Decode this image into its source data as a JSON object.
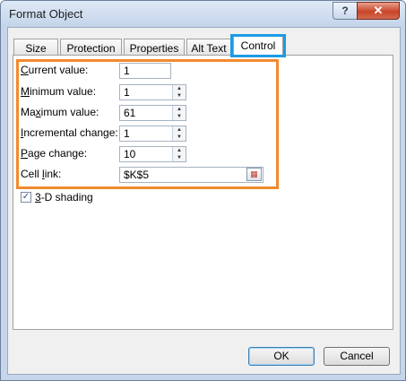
{
  "window": {
    "title": "Format Object",
    "help": "?",
    "close": "✕"
  },
  "tabs": [
    "Size",
    "Protection",
    "Properties",
    "Alt Text",
    "Control"
  ],
  "fields": {
    "current_value": {
      "label_key": "C",
      "label_rest": "urrent value:",
      "value": "1"
    },
    "minimum_value": {
      "label_key": "M",
      "label_rest": "inimum value:",
      "value": "1"
    },
    "maximum_value": {
      "label_pre": "Ma",
      "label_key": "x",
      "label_rest": "imum value:",
      "value": "61"
    },
    "incremental_change": {
      "label_key": "I",
      "label_rest": "ncremental change:",
      "value": "1"
    },
    "page_change": {
      "label_key": "P",
      "label_rest": "age change:",
      "value": "10"
    },
    "cell_link": {
      "label_pre": "Cell ",
      "label_key": "l",
      "label_rest": "ink:",
      "value": "$K$5"
    }
  },
  "shading": {
    "key": "3",
    "rest": "-D shading",
    "checked": "✓"
  },
  "buttons": {
    "ok": "OK",
    "cancel": "Cancel"
  },
  "colors": {
    "tab_highlight": "#1c9be6",
    "field_highlight": "#f28a2e"
  }
}
